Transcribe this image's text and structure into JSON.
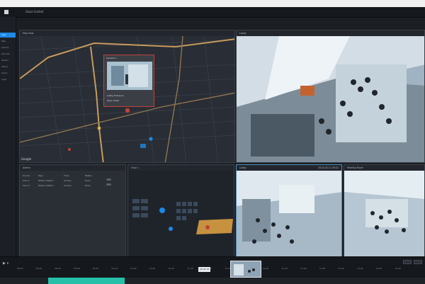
{
  "window": {
    "title": "Ganz Cortrol"
  },
  "sidebar": {
    "items": [
      {
        "label": "Live",
        "active": true
      },
      {
        "label": "Map"
      },
      {
        "label": "Alarms"
      },
      {
        "label": "Devices"
      },
      {
        "label": "Export"
      },
      {
        "label": "Setup"
      },
      {
        "label": "Users"
      },
      {
        "label": "Logs"
      }
    ]
  },
  "map_panel": {
    "title": "Map View",
    "popup": {
      "title": "Camera 1",
      "line1": "Lobby Entrance",
      "line2": "Open Video"
    },
    "google_label": "Google"
  },
  "camera_top": {
    "title": "Lobby"
  },
  "alarm_panel": {
    "title": "Alarms",
    "columns": [
      "Source",
      "Type",
      "Time",
      "Status"
    ],
    "rows": [
      [
        "Cam 1",
        "Motion Detect",
        "Access",
        "Front"
      ],
      [
        "Cam 2",
        "Motion Detect",
        "Access",
        "Front"
      ]
    ]
  },
  "floor_panel": {
    "title": "Floor 1"
  },
  "camera_bl": {
    "title": "Lobby",
    "timestamp": "2024-03-12 09:41"
  },
  "camera_br": {
    "title": "Meeting Room"
  },
  "timeline": {
    "ticks": [
      "08:00",
      "08:20",
      "08:40",
      "09:00",
      "09:20",
      "09:40",
      "10:00",
      "10:20",
      "10:40",
      "11:00",
      "11:20",
      "11:40",
      "12:00",
      "12:20",
      "12:40",
      "13:00",
      "13:20",
      "13:40",
      "14:00",
      "14:20",
      "14:40"
    ],
    "cursor_label": "09:41:25",
    "progress_fraction": 0.18
  },
  "colors": {
    "accent": "#1e88e5",
    "alert": "#c2413a",
    "timeline_fill": "#26c0a9"
  }
}
